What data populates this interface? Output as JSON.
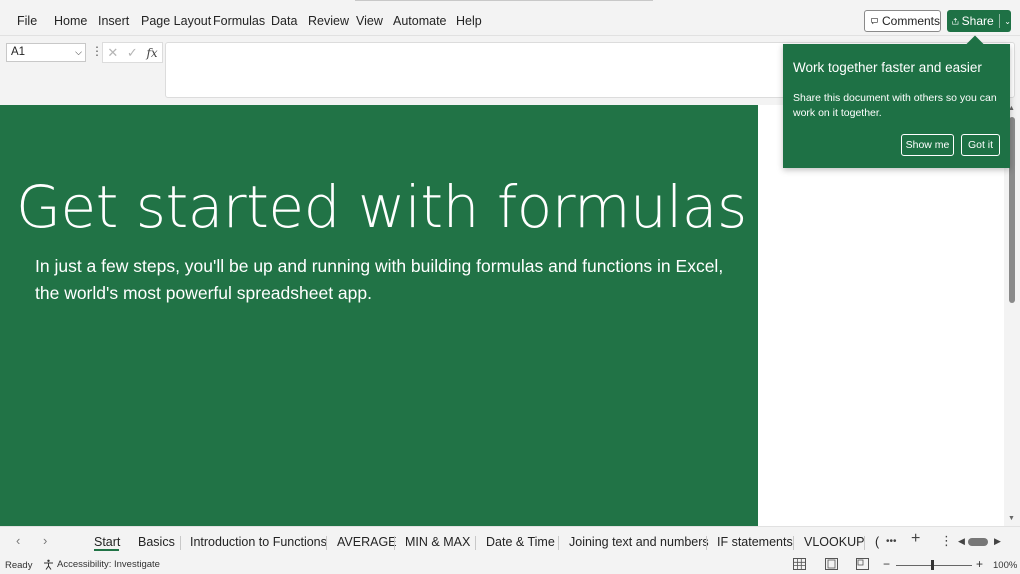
{
  "menu": {
    "items": [
      "File",
      "Home",
      "Insert",
      "Page Layout",
      "Formulas",
      "Data",
      "Review",
      "View",
      "Automate",
      "Help"
    ],
    "comments_label": "Comments",
    "share_label": "Share"
  },
  "formula_bar": {
    "name_box": "A1",
    "formula": ""
  },
  "sheet": {
    "heading": "Get started with formulas",
    "intro": "In just a few steps, you'll be up and running with building formulas and functions in Excel, the world's most powerful spreadsheet app.",
    "banner_color": "#217346"
  },
  "callout": {
    "title": "Work together faster and easier",
    "body": "Share this document with others so you can work on it together.",
    "show_me": "Show me",
    "got_it": "Got it"
  },
  "tabs": {
    "items": [
      "Start",
      "Basics",
      "Introduction to Functions",
      "AVERAGE",
      "MIN & MAX",
      "Date & Time",
      "Joining text and numbers",
      "IF statements",
      "VLOOKUP",
      "("
    ],
    "active": "Start",
    "more": "•••"
  },
  "status": {
    "ready": "Ready",
    "accessibility": "Accessibility: Investigate",
    "zoom": "100%"
  },
  "colors": {
    "accent": "#217346",
    "callout": "#1e7145"
  }
}
